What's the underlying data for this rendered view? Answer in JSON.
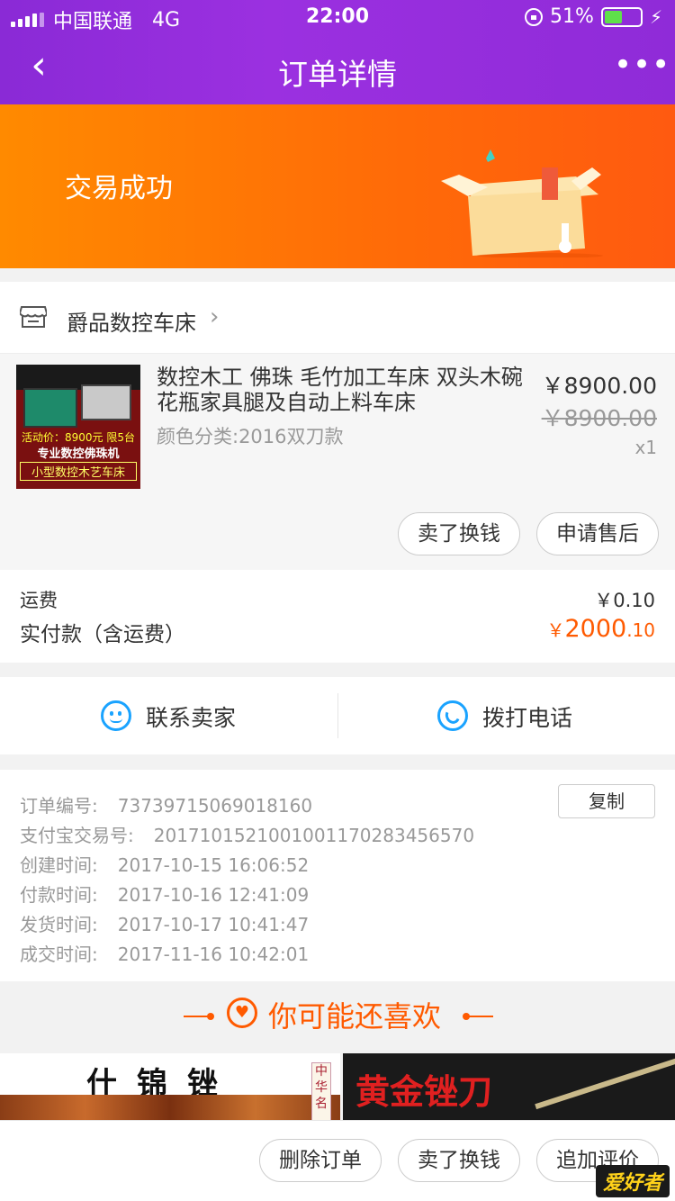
{
  "status_bar": {
    "carrier": "中国联通",
    "network": "4G",
    "time": "22:00",
    "battery": "51%",
    "battery_level": 0.51
  },
  "nav": {
    "back_icon": "back-chevron",
    "title": "订单详情",
    "more_icon": "more-dots",
    "more_label": "•••"
  },
  "banner": {
    "status": "交易成功",
    "colors": {
      "start": "#ff8a00",
      "end": "#ff5a10"
    }
  },
  "shop": {
    "name": "爵品数控车床",
    "chevron": "›"
  },
  "item": {
    "title": "数控木工 佛珠 毛竹加工车床 双头木碗花瓶家具腿及自动上料车床",
    "sku": "颜色分类:2016双刀款",
    "price": "￥8900.00",
    "original_price": "￥8900.00",
    "quantity": "x1",
    "thumb_text": {
      "promo": "活动价：8900元 限5台",
      "line1": "专业数控佛珠机",
      "line2": "小型数控木艺车床"
    },
    "buttons": {
      "sell": "卖了换钱",
      "after_sale": "申请售后"
    }
  },
  "totals": {
    "shipping_label": "运费",
    "shipping_value": "￥0.10",
    "paid_label": "实付款（含运费）",
    "paid_currency": "￥",
    "paid_main": "2000",
    "paid_decimal": ".10",
    "accent": "#ff5a00"
  },
  "contact": {
    "seller": "联系卖家",
    "call": "拨打电话",
    "accent": "#1aa3ff"
  },
  "info": {
    "copy_button": "复制",
    "rows": [
      {
        "label": "订单编号:",
        "value": "73739715069018160"
      },
      {
        "label": "支付宝交易号:",
        "value": "2017101521001001170283456570"
      },
      {
        "label": "创建时间:",
        "value": "2017-10-15 16:06:52"
      },
      {
        "label": "付款时间:",
        "value": "2017-10-16 12:41:09"
      },
      {
        "label": "发货时间:",
        "value": "2017-10-17 10:41:47"
      },
      {
        "label": "成交时间:",
        "value": "2017-11-16 10:42:01"
      }
    ]
  },
  "recommend": {
    "title": "你可能还喜欢",
    "promo_left": {
      "title": "什锦锉",
      "seal": "中华名"
    },
    "promo_right": {
      "title": "黄金锉刀"
    }
  },
  "bottom_bar": {
    "delete": "删除订单",
    "sell": "卖了换钱",
    "review": "追加评价",
    "watermark": "爱好者"
  }
}
